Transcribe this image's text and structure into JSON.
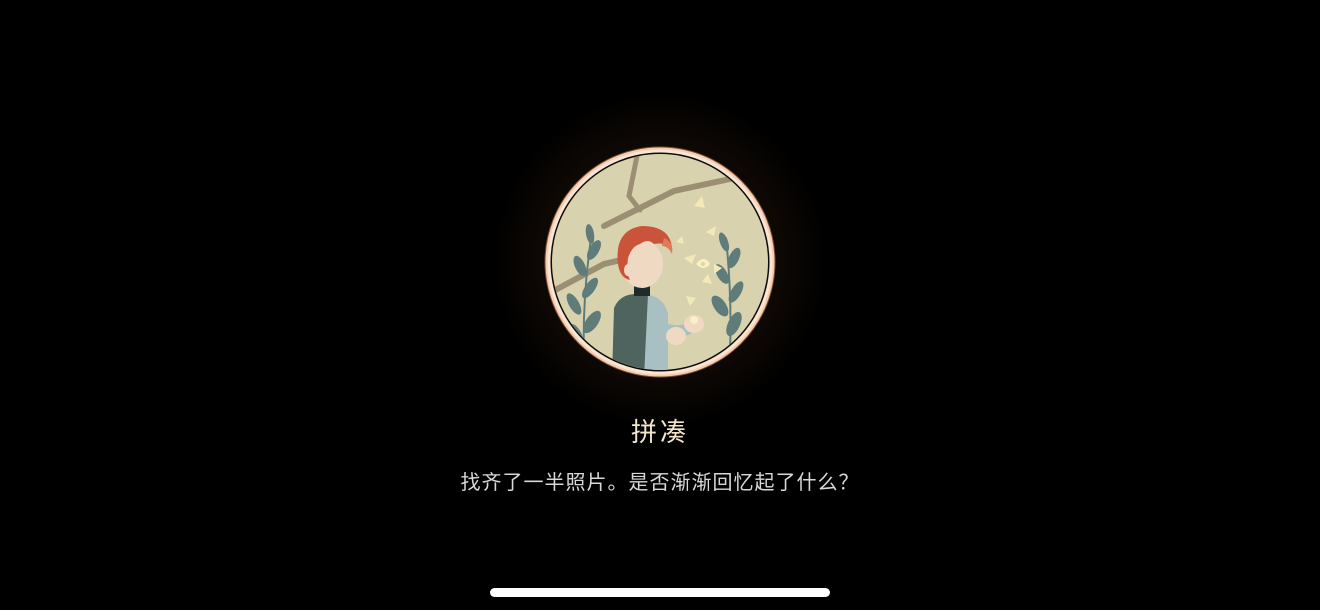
{
  "achievement": {
    "title": "拼凑",
    "description": "找齐了一半照片。是否渐渐回忆起了什么？",
    "image_icon": "boy-with-butterflies-icon"
  },
  "colors": {
    "background": "#000000",
    "ring": "#f6e6d6",
    "glow": "#b47850",
    "badge_fill": "#d9d2ae",
    "title_text": "#f3e6c9",
    "description_text": "#d8d8d8"
  },
  "system": {
    "home_indicator_icon": "home-indicator-bar"
  }
}
